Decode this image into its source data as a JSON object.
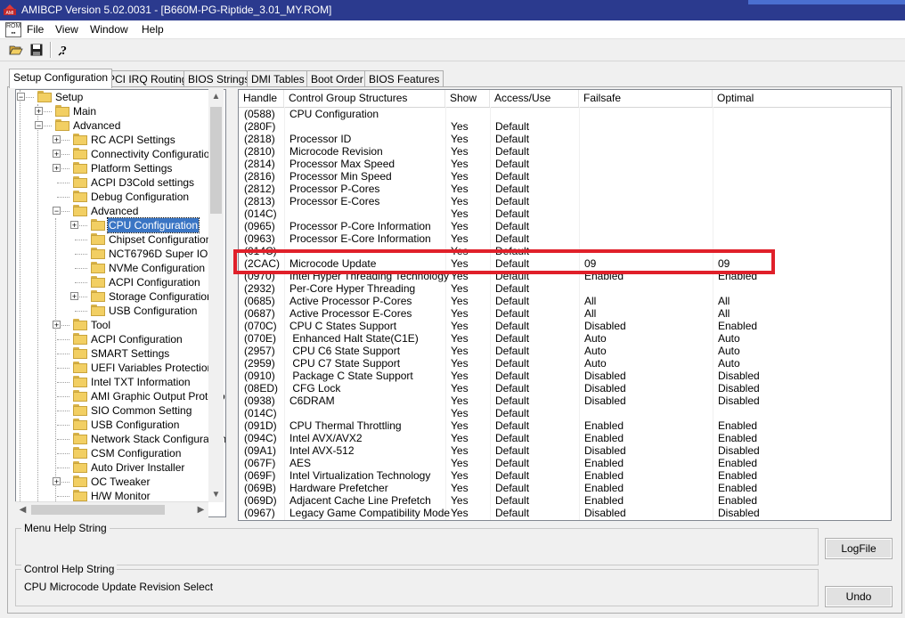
{
  "window": {
    "title": "AMIBCP Version 5.02.0031 - [B660M-PG-Riptide_3.01_MY.ROM]",
    "icon": "amibcp-app-icon",
    "accent": "#2b3a8e"
  },
  "menu": [
    "File",
    "View",
    "Window",
    "Help"
  ],
  "toolbar": {
    "buttons": [
      "open-folder-icon",
      "save-disk-icon",
      "help-question-icon"
    ]
  },
  "tabs": [
    "Setup Configuration",
    "PCI IRQ Routing",
    "BIOS Strings",
    "DMI Tables",
    "Boot Order",
    "BIOS Features"
  ],
  "active_tab": "Setup Configuration",
  "tree": [
    {
      "label": "Setup",
      "level": 0,
      "expander": "minus",
      "open": true
    },
    {
      "label": "Main",
      "level": 1,
      "expander": "plus",
      "open": false
    },
    {
      "label": "Advanced",
      "level": 1,
      "expander": "minus",
      "open": true
    },
    {
      "label": "RC ACPI Settings",
      "level": 2,
      "expander": "plus",
      "open": false
    },
    {
      "label": "Connectivity Configuration",
      "level": 2,
      "expander": "plus",
      "open": false
    },
    {
      "label": "Platform Settings",
      "level": 2,
      "expander": "plus",
      "open": false
    },
    {
      "label": "ACPI D3Cold settings",
      "level": 2,
      "expander": "none",
      "open": false
    },
    {
      "label": "Debug Configuration",
      "level": 2,
      "expander": "none",
      "open": false
    },
    {
      "label": "Advanced",
      "level": 2,
      "expander": "minus",
      "open": true
    },
    {
      "label": "CPU Configuration",
      "level": 3,
      "expander": "plus",
      "open": true,
      "selected": true
    },
    {
      "label": "Chipset Configuration",
      "level": 3,
      "expander": "none",
      "open": false
    },
    {
      "label": "NCT6796D Super IO",
      "level": 3,
      "expander": "none",
      "open": false
    },
    {
      "label": "NVMe Configuration",
      "level": 3,
      "expander": "none",
      "open": false
    },
    {
      "label": "ACPI Configuration",
      "level": 3,
      "expander": "none",
      "open": false
    },
    {
      "label": "Storage Configuration",
      "level": 3,
      "expander": "plus",
      "open": false
    },
    {
      "label": "USB Configuration",
      "level": 3,
      "expander": "none",
      "open": false
    },
    {
      "label": "Tool",
      "level": 2,
      "expander": "plus",
      "open": false
    },
    {
      "label": "ACPI Configuration",
      "level": 2,
      "expander": "none",
      "open": false
    },
    {
      "label": "SMART Settings",
      "level": 2,
      "expander": "none",
      "open": false
    },
    {
      "label": "UEFI Variables Protection",
      "level": 2,
      "expander": "none",
      "open": false
    },
    {
      "label": "Intel TXT Information",
      "level": 2,
      "expander": "none",
      "open": false
    },
    {
      "label": "AMI Graphic Output Protocol",
      "level": 2,
      "expander": "none",
      "open": false
    },
    {
      "label": "SIO Common Setting",
      "level": 2,
      "expander": "none",
      "open": false
    },
    {
      "label": "USB Configuration",
      "level": 2,
      "expander": "none",
      "open": false
    },
    {
      "label": "Network Stack Configuration",
      "level": 2,
      "expander": "none",
      "open": false
    },
    {
      "label": "CSM Configuration",
      "level": 2,
      "expander": "none",
      "open": false
    },
    {
      "label": "Auto Driver Installer",
      "level": 2,
      "expander": "none",
      "open": false
    },
    {
      "label": "OC Tweaker",
      "level": 2,
      "expander": "plus",
      "open": false
    },
    {
      "label": "H/W Monitor",
      "level": 2,
      "expander": "none",
      "open": false
    }
  ],
  "grid": {
    "headers": [
      "Handle",
      "Control Group Structures",
      "Show",
      "Access/Use",
      "Failsafe",
      "Optimal"
    ],
    "rows": [
      [
        "(0588)",
        "CPU Configuration",
        "",
        "",
        "",
        ""
      ],
      [
        "(280F)",
        "",
        "Yes",
        "Default",
        "",
        ""
      ],
      [
        "(2818)",
        "Processor ID",
        "Yes",
        "Default",
        "",
        ""
      ],
      [
        "(2810)",
        "Microcode Revision",
        "Yes",
        "Default",
        "",
        ""
      ],
      [
        "(2814)",
        "Processor Max Speed",
        "Yes",
        "Default",
        "",
        ""
      ],
      [
        "(2816)",
        "Processor Min Speed",
        "Yes",
        "Default",
        "",
        ""
      ],
      [
        "(2812)",
        "Processor P-Cores",
        "Yes",
        "Default",
        "",
        ""
      ],
      [
        "(2813)",
        "Processor E-Cores",
        "Yes",
        "Default",
        "",
        ""
      ],
      [
        "(014C)",
        "",
        "Yes",
        "Default",
        "",
        ""
      ],
      [
        "(0965)",
        "Processor P-Core Information",
        "Yes",
        "Default",
        "",
        ""
      ],
      [
        "(0963)",
        "Processor E-Core Information",
        "Yes",
        "Default",
        "",
        ""
      ],
      [
        "(014C)",
        "",
        "Yes",
        "Default",
        "",
        ""
      ],
      [
        "(2CAC)",
        "Microcode Update",
        "Yes",
        "Default",
        "09",
        "09"
      ],
      [
        "(0970)",
        "Intel Hyper Threading Technology",
        "Yes",
        "Default",
        "Enabled",
        "Enabled"
      ],
      [
        "(2932)",
        "Per-Core Hyper Threading",
        "Yes",
        "Default",
        "",
        ""
      ],
      [
        "(0685)",
        "Active Processor P-Cores",
        "Yes",
        "Default",
        "All",
        "All"
      ],
      [
        "(0687)",
        "Active Processor E-Cores",
        "Yes",
        "Default",
        "All",
        "All"
      ],
      [
        "(070C)",
        "CPU C States Support",
        "Yes",
        "Default",
        "Disabled",
        "Enabled"
      ],
      [
        "(070E)",
        " Enhanced Halt State(C1E)",
        "Yes",
        "Default",
        "Auto",
        "Auto"
      ],
      [
        "(2957)",
        " CPU C6 State Support",
        "Yes",
        "Default",
        "Auto",
        "Auto"
      ],
      [
        "(2959)",
        " CPU C7 State Support",
        "Yes",
        "Default",
        "Auto",
        "Auto"
      ],
      [
        "(0910)",
        " Package C State Support",
        "Yes",
        "Default",
        "Disabled",
        "Disabled"
      ],
      [
        "(08ED)",
        " CFG Lock",
        "Yes",
        "Default",
        "Disabled",
        "Disabled"
      ],
      [
        "(0938)",
        "C6DRAM",
        "Yes",
        "Default",
        "Disabled",
        "Disabled"
      ],
      [
        "(014C)",
        "",
        "Yes",
        "Default",
        "",
        ""
      ],
      [
        "(091D)",
        "CPU Thermal Throttling",
        "Yes",
        "Default",
        "Enabled",
        "Enabled"
      ],
      [
        "(094C)",
        "Intel AVX/AVX2",
        "Yes",
        "Default",
        "Enabled",
        "Enabled"
      ],
      [
        "(09A1)",
        "Intel AVX-512",
        "Yes",
        "Default",
        "Disabled",
        "Disabled"
      ],
      [
        "(067F)",
        "AES",
        "Yes",
        "Default",
        "Enabled",
        "Enabled"
      ],
      [
        "(069F)",
        "Intel Virtualization Technology",
        "Yes",
        "Default",
        "Enabled",
        "Enabled"
      ],
      [
        "(069B)",
        "Hardware Prefetcher",
        "Yes",
        "Default",
        "Enabled",
        "Enabled"
      ],
      [
        "(069D)",
        "Adjacent Cache Line Prefetch",
        "Yes",
        "Default",
        "Enabled",
        "Enabled"
      ],
      [
        "(0967)",
        "Legacy Game Compatibility Mode",
        "Yes",
        "Default",
        "Disabled",
        "Disabled"
      ]
    ],
    "highlighted_row": "(2CAC)",
    "highlight_color": "#e0202a"
  },
  "help": {
    "menu_caption": "Menu Help String",
    "menu_text": "",
    "control_caption": "Control Help String",
    "control_text": "CPU Microcode Update Revision Select"
  },
  "buttons": {
    "logfile": "LogFile",
    "undo": "Undo"
  }
}
